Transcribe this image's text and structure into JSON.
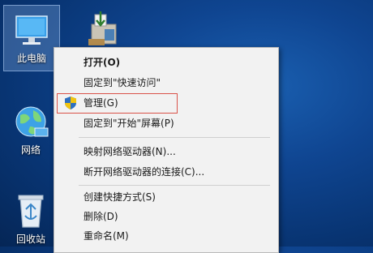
{
  "desktop": {
    "icons": [
      {
        "label": "此电脑",
        "icon": "computer-icon",
        "selected": true
      },
      {
        "label": "",
        "icon": "installer-package-icon"
      },
      {
        "label": "网络",
        "icon": "network-globe-icon"
      },
      {
        "label": "回收站",
        "icon": "recycle-bin-icon"
      }
    ]
  },
  "context_menu": {
    "items": [
      {
        "label": "打开(O)",
        "bold": true
      },
      {
        "label": "固定到\"快速访问\""
      },
      {
        "label": "管理(G)",
        "icon": "shield-icon",
        "highlighted": true
      },
      {
        "label": "固定到\"开始\"屏幕(P)"
      },
      {
        "label": "映射网络驱动器(N)..."
      },
      {
        "label": "断开网络驱动器的连接(C)..."
      },
      {
        "label": "创建快捷方式(S)"
      },
      {
        "label": "删除(D)"
      },
      {
        "label": "重命名(M)"
      }
    ]
  },
  "colors": {
    "desktop_bg": "#0f4591",
    "menu_bg": "#f2f2f2",
    "highlight_border": "#d9534a"
  }
}
